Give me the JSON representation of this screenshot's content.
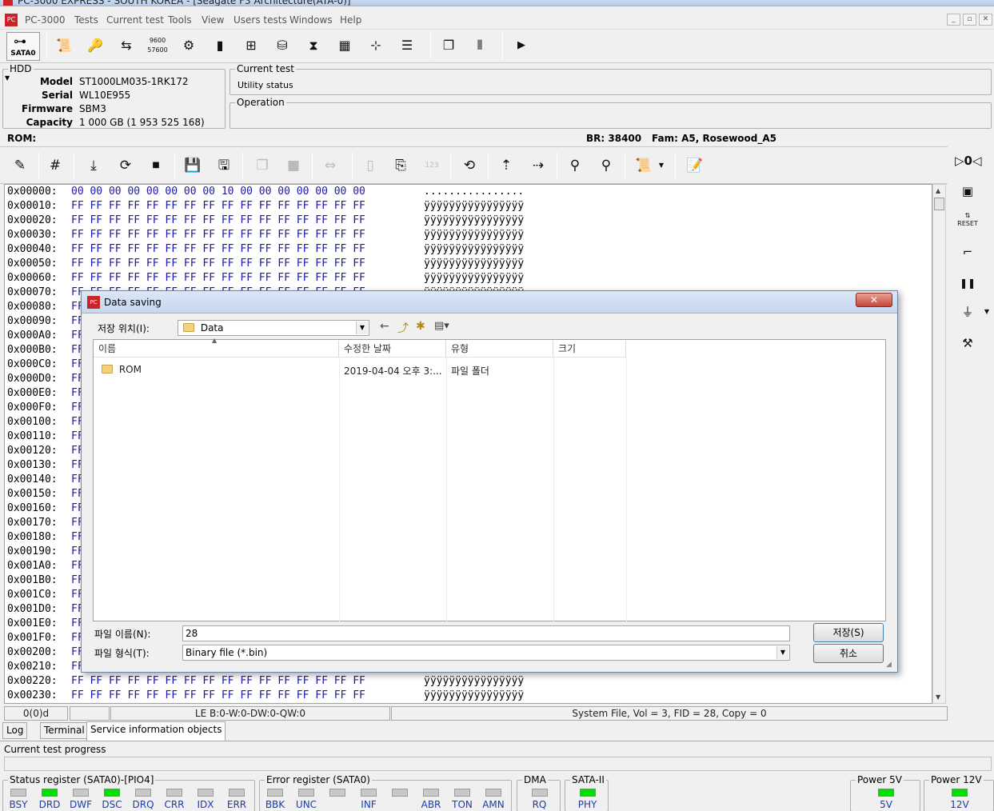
{
  "window": {
    "title": "PC-3000 EXPRESS - SOUTH KOREA - [Seagate F3 Architecture(ATA-0)]"
  },
  "menu": [
    "PC-3000",
    "Tests",
    "Current test",
    "Tools",
    "View",
    "Users tests",
    "Windows",
    "Help"
  ],
  "toolbar": {
    "port_label": "SATA0",
    "rom_label": "ROM:",
    "br": "BR: 38400",
    "fam": "Fam: A5, Rosewood_A5"
  },
  "hdd": {
    "group_label": "HDD",
    "model_label": "Model",
    "model": "ST1000LM035-1RK172",
    "serial_label": "Serial",
    "serial": "WL10E955",
    "firmware_label": "Firmware",
    "firmware": "SBM3",
    "capacity_label": "Capacity",
    "capacity": "1 000 GB (1 953 525 168)"
  },
  "current_test": {
    "label": "Current test",
    "value": "Utility status",
    "operation_label": "Operation"
  },
  "hex": {
    "rows": [
      {
        "offset": "0x00000:",
        "bytes": "00 00 00 00 00 00 00 00 10 00 00 00 00 00 00 00",
        "ascii": "................"
      },
      {
        "offset": "0x00010:",
        "bytes": "FF FF FF FF FF FF FF FF FF FF FF FF FF FF FF FF",
        "ascii": "ÿÿÿÿÿÿÿÿÿÿÿÿÿÿÿÿ"
      },
      {
        "offset": "0x00020:",
        "bytes": "FF FF FF FF FF FF FF FF FF FF FF FF FF FF FF FF",
        "ascii": "ÿÿÿÿÿÿÿÿÿÿÿÿÿÿÿÿ"
      },
      {
        "offset": "0x00030:",
        "bytes": "FF FF FF FF FF FF FF FF FF FF FF FF FF FF FF FF",
        "ascii": "ÿÿÿÿÿÿÿÿÿÿÿÿÿÿÿÿ"
      },
      {
        "offset": "0x00040:",
        "bytes": "FF FF FF FF FF FF FF FF FF FF FF FF FF FF FF FF",
        "ascii": "ÿÿÿÿÿÿÿÿÿÿÿÿÿÿÿÿ"
      },
      {
        "offset": "0x00050:",
        "bytes": "FF FF FF FF FF FF FF FF FF FF FF FF FF FF FF FF",
        "ascii": "ÿÿÿÿÿÿÿÿÿÿÿÿÿÿÿÿ"
      },
      {
        "offset": "0x00060:",
        "bytes": "FF FF FF FF FF FF FF FF FF FF FF FF FF FF FF FF",
        "ascii": "ÿÿÿÿÿÿÿÿÿÿÿÿÿÿÿÿ"
      },
      {
        "offset": "0x00070:",
        "bytes": "FF FF FF FF FF FF FF FF FF FF FF FF FF FF FF FF",
        "ascii": "ÿÿÿÿÿÿÿÿÿÿÿÿÿÿÿÿ"
      },
      {
        "offset": "0x00080:",
        "bytes": "FF",
        "ascii": ""
      },
      {
        "offset": "0x00090:",
        "bytes": "FF",
        "ascii": ""
      },
      {
        "offset": "0x000A0:",
        "bytes": "FF",
        "ascii": ""
      },
      {
        "offset": "0x000B0:",
        "bytes": "FF",
        "ascii": ""
      },
      {
        "offset": "0x000C0:",
        "bytes": "FF",
        "ascii": ""
      },
      {
        "offset": "0x000D0:",
        "bytes": "FF",
        "ascii": ""
      },
      {
        "offset": "0x000E0:",
        "bytes": "FF",
        "ascii": ""
      },
      {
        "offset": "0x000F0:",
        "bytes": "FF",
        "ascii": ""
      },
      {
        "offset": "0x00100:",
        "bytes": "FF",
        "ascii": ""
      },
      {
        "offset": "0x00110:",
        "bytes": "FF",
        "ascii": ""
      },
      {
        "offset": "0x00120:",
        "bytes": "FF",
        "ascii": ""
      },
      {
        "offset": "0x00130:",
        "bytes": "FF",
        "ascii": ""
      },
      {
        "offset": "0x00140:",
        "bytes": "FF",
        "ascii": ""
      },
      {
        "offset": "0x00150:",
        "bytes": "FF",
        "ascii": ""
      },
      {
        "offset": "0x00160:",
        "bytes": "FF",
        "ascii": ""
      },
      {
        "offset": "0x00170:",
        "bytes": "FF",
        "ascii": ""
      },
      {
        "offset": "0x00180:",
        "bytes": "FF",
        "ascii": ""
      },
      {
        "offset": "0x00190:",
        "bytes": "FF",
        "ascii": ""
      },
      {
        "offset": "0x001A0:",
        "bytes": "FF",
        "ascii": ""
      },
      {
        "offset": "0x001B0:",
        "bytes": "FF",
        "ascii": ""
      },
      {
        "offset": "0x001C0:",
        "bytes": "FF",
        "ascii": ""
      },
      {
        "offset": "0x001D0:",
        "bytes": "FF",
        "ascii": ""
      },
      {
        "offset": "0x001E0:",
        "bytes": "FF",
        "ascii": ""
      },
      {
        "offset": "0x001F0:",
        "bytes": "FF",
        "ascii": ""
      },
      {
        "offset": "0x00200:",
        "bytes": "FF",
        "ascii": ""
      },
      {
        "offset": "0x00210:",
        "bytes": "FF",
        "ascii": ""
      },
      {
        "offset": "0x00220:",
        "bytes": "FF FF FF FF FF FF FF FF FF FF FF FF FF FF FF FF",
        "ascii": "ÿÿÿÿÿÿÿÿÿÿÿÿÿÿÿÿ"
      },
      {
        "offset": "0x00230:",
        "bytes": "FF FF FF FF FF FF FF FF FF FF FF FF FF FF FF FF",
        "ascii": "ÿÿÿÿÿÿÿÿÿÿÿÿÿÿÿÿ"
      }
    ]
  },
  "statusline": {
    "pos": "0(0)d",
    "le": "LE B:0-W:0-DW:0-QW:0",
    "info": "System File, Vol = 3, FID = 28, Copy = 0"
  },
  "tabs": [
    "Log",
    "Terminal",
    "Service information objects"
  ],
  "progress_label": "Current test progress",
  "registers": {
    "status": {
      "label": "Status register (SATA0)-[PIO4]",
      "leds": [
        {
          "name": "BSY",
          "on": false
        },
        {
          "name": "DRD",
          "on": true
        },
        {
          "name": "DWF",
          "on": false
        },
        {
          "name": "DSC",
          "on": true
        },
        {
          "name": "DRQ",
          "on": false
        },
        {
          "name": "CRR",
          "on": false
        },
        {
          "name": "IDX",
          "on": false
        },
        {
          "name": "ERR",
          "on": false
        }
      ]
    },
    "error": {
      "label": "Error register (SATA0)",
      "leds": [
        {
          "name": "BBK",
          "on": false
        },
        {
          "name": "UNC",
          "on": false
        },
        {
          "name": "",
          "on": false
        },
        {
          "name": "INF",
          "on": false
        },
        {
          "name": "",
          "on": false
        },
        {
          "name": "ABR",
          "on": false
        },
        {
          "name": "TON",
          "on": false
        },
        {
          "name": "AMN",
          "on": false
        }
      ]
    },
    "dma": {
      "label": "DMA",
      "leds": [
        {
          "name": "RQ",
          "on": false
        }
      ]
    },
    "sata": {
      "label": "SATA-II",
      "leds": [
        {
          "name": "PHY",
          "on": true
        }
      ]
    },
    "p5": {
      "label": "Power 5V",
      "leds": [
        {
          "name": "5V",
          "on": true
        }
      ]
    },
    "p12": {
      "label": "Power 12V",
      "leds": [
        {
          "name": "12V",
          "on": true
        }
      ]
    }
  },
  "dialog": {
    "title": "Data saving",
    "save_in_label": "저장 위치(I):",
    "save_in_value": "Data",
    "columns": [
      "이름",
      "수정한 날짜",
      "유형",
      "크기"
    ],
    "files": [
      {
        "name": "ROM",
        "date": "2019-04-04 오후 3:...",
        "type": "파일 폴더",
        "size": ""
      }
    ],
    "filename_label": "파일 이름(N):",
    "filename_value": "28",
    "filetype_label": "파일 형식(T):",
    "filetype_value": "Binary file (*.bin)",
    "save_button": "저장(S)",
    "cancel_button": "취소"
  }
}
